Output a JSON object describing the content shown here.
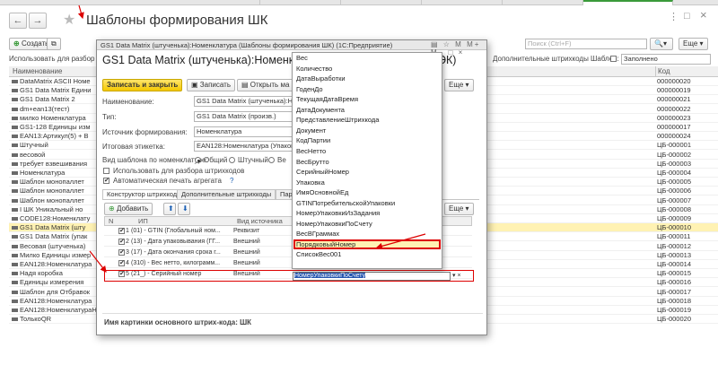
{
  "window": {
    "title": "Шаблоны формирования ШК",
    "back_icon": "←",
    "forward_icon": "→",
    "star_icon": "★",
    "menu_icon": "⋮",
    "max_icon": "□",
    "close_icon": "×"
  },
  "list_toolbar": {
    "create": "Создать",
    "search_placeholder": "Поиск (Ctrl+F)",
    "more": "Еще",
    "filter_left": "Использовать для разбор",
    "filter_right_label": "Дополнительные штрихкоды Шаблон:",
    "filter_right_value": "Заполнено"
  },
  "list": {
    "col_name": "Наименование",
    "col_code": "Код",
    "rows": [
      {
        "name": "DataMatrix ASCII Номе",
        "code": "000000020"
      },
      {
        "name": "GS1 Data Matrix Едини",
        "code": "000000019"
      },
      {
        "name": "GS1 Data Matrix 2",
        "code": "000000021"
      },
      {
        "name": "dm+ean13(тест)",
        "code": "000000022"
      },
      {
        "name": "милко Номенклатура",
        "code": "000000023"
      },
      {
        "name": "GS1-128 Единицы изм",
        "code": "000000017"
      },
      {
        "name": "EAN13:Артикул(5) + В",
        "code": "000000024"
      },
      {
        "name": "Штучный",
        "code": "ЦБ-000001"
      },
      {
        "name": "весовой",
        "code": "ЦБ-000002"
      },
      {
        "name": "требует взвешивания",
        "code": "ЦБ-000003"
      },
      {
        "name": "Номенклатура",
        "code": "ЦБ-000004"
      },
      {
        "name": "Шаблон монопаллет",
        "code": "ЦБ-000005"
      },
      {
        "name": "Шаблон монопаллет",
        "code": "ЦБ-000006"
      },
      {
        "name": "Шаблон монопаллет",
        "code": "ЦБ-000007"
      },
      {
        "name": "I ШК Уникальный но",
        "code": "ЦБ-000008"
      },
      {
        "name": "CODE128:Номенклату",
        "code": "ЦБ-000009"
      },
      {
        "name": "GS1 Data Matrix (шту",
        "code": "ЦБ-000010"
      },
      {
        "name": "GS1 Data Matrix (упак",
        "code": "ЦБ-000011"
      },
      {
        "name": "Весовая (штученька)",
        "code": "ЦБ-000012"
      },
      {
        "name": "Милко Единицы измер",
        "code": "ЦБ-000013"
      },
      {
        "name": "EAN128:Номенклатура",
        "code": "ЦБ-000014"
      },
      {
        "name": "Надя коробка",
        "code": "ЦБ-000015"
      },
      {
        "name": "Единицы измерения",
        "code": "ЦБ-000016"
      },
      {
        "name": "Шаблон для Отбравок",
        "code": "ЦБ-000017"
      },
      {
        "name": "EAN128:Номенклатура",
        "code": "ЦБ-000018"
      },
      {
        "name": "EAN128:НоменклатураНадяОбычнаяАгрегация",
        "code": "ЦБ-000019"
      },
      {
        "name": "ТолькоQR",
        "code": "ЦБ-000020"
      }
    ]
  },
  "modal": {
    "title": "GS1 Data Matrix (штученька):Номенклатура (Шаблоны формирования ШК)  (1С:Предприятие)",
    "heading": "GS1 Data Matrix (штученька):Номенклат",
    "heading_tail": "ЭК)",
    "btn_save_close": "Записать и закрыть",
    "btn_save": "Записать",
    "btn_open": "Открыть ма",
    "more": "Еще",
    "field_name_label": "Наименование:",
    "field_name_value": "GS1 Data Matrix (штученька):Но",
    "field_type_label": "Тип:",
    "field_type_value": "GS1 Data Matrix (произв.)",
    "field_source_label": "Источник формирования:",
    "field_source_value": "Номенклатура",
    "field_label_label": "Итоговая этикетка:",
    "field_label_value": "EAN128:Номенклатура (Упаковоч",
    "view_label": "Вид шаблона по номенклатуре:",
    "radio_common": "Общий",
    "radio_piece": "Штучный",
    "radio_weight": "Ве",
    "chk_parse": "Использовать для разбора штрихкодов",
    "chk_print": "Автоматическая печать агрегата",
    "help": "?",
    "tab_constructor": "Конструктор штрихкода",
    "tab_additional": "Дополнительные штрихкоды",
    "tab_params": "Пара",
    "btn_add": "Добавить",
    "col_n": "N",
    "col_ai": "ИП",
    "col_source": "Вид источника",
    "rows": [
      {
        "n": "1",
        "ai": "(01) - GTIN (Глобальный ном...",
        "src": "Реквизит"
      },
      {
        "n": "2",
        "ai": "(13) - Дата упаковывания (ГГ...",
        "src": "Внешний"
      },
      {
        "n": "3",
        "ai": "(17) - Дата окончания срока г...",
        "src": "Внешний"
      },
      {
        "n": "4",
        "ai": "(310) - Вес нетто, килограмм...",
        "src": "Внешний"
      },
      {
        "n": "5",
        "ai": "(21_) - Серийный номер",
        "src": "Внешний",
        "value": "НомерУпаковкиПоСчету"
      }
    ],
    "footer": "Имя картинки основного штрих-кода: ШК"
  },
  "dropdown": {
    "items": [
      "Вес",
      "Количество",
      "ДатаВыработки",
      "ГоденДо",
      "ТекущаяДатаВремя",
      "ДатаДокумента",
      "ПредставлениеШтрихкода",
      "Документ",
      "КодПартии",
      "ВесНетто",
      "ВесБрутто",
      "СерийныйНомер",
      "Упаковка",
      "ИмяОсновнойЕд",
      "GTINПотребительскойУпаковки",
      "НомерУпаковкиИзЗадания",
      "НомерУпаковкиПоСчету",
      "ВесВГраммах",
      "ПорядковыйНомер",
      "СписокВес001"
    ],
    "highlighted_index": 18
  },
  "colors": {
    "accent": "#f5c800",
    "highlight": "#fff2b3",
    "annotation": "#dd0000"
  }
}
